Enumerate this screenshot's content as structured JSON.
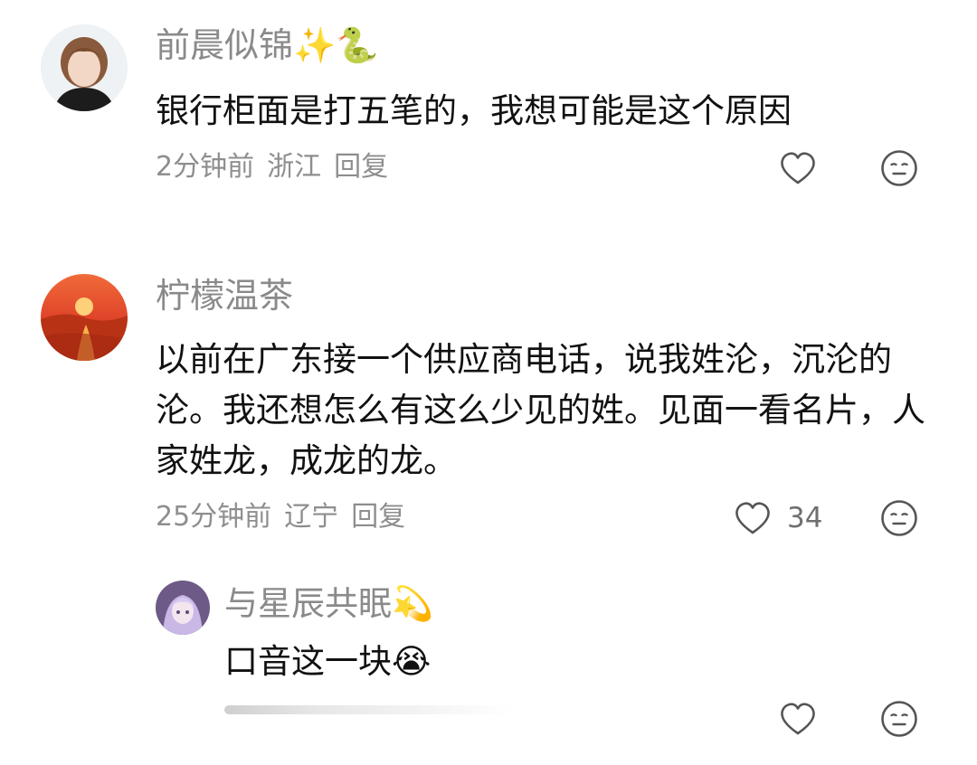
{
  "comments": [
    {
      "username": "前晨似锦",
      "username_emoji": "✨🐍",
      "text": "银行柜面是打五笔的，我想可能是这个原因",
      "time": "2分钟前",
      "location": "浙江",
      "reply_label": "回复",
      "like_count": ""
    },
    {
      "username": "柠檬温茶",
      "username_emoji": "",
      "text": "以前在广东接一个供应商电话，说我姓沦，沉沦的沦。我还想怎么有这么少见的姓。见面一看名片，人家姓龙，成龙的龙。",
      "time": "25分钟前",
      "location": "辽宁",
      "reply_label": "回复",
      "like_count": "34"
    }
  ],
  "reply": {
    "username": "与星辰共眠",
    "username_emoji": "💫",
    "text": "口音这一块",
    "text_emoji": "😭"
  },
  "colors": {
    "name": "#8a8a8a",
    "text": "#111111",
    "meta": "#8e8e8e"
  },
  "icons": [
    "heart-icon",
    "neutral-face-icon"
  ]
}
